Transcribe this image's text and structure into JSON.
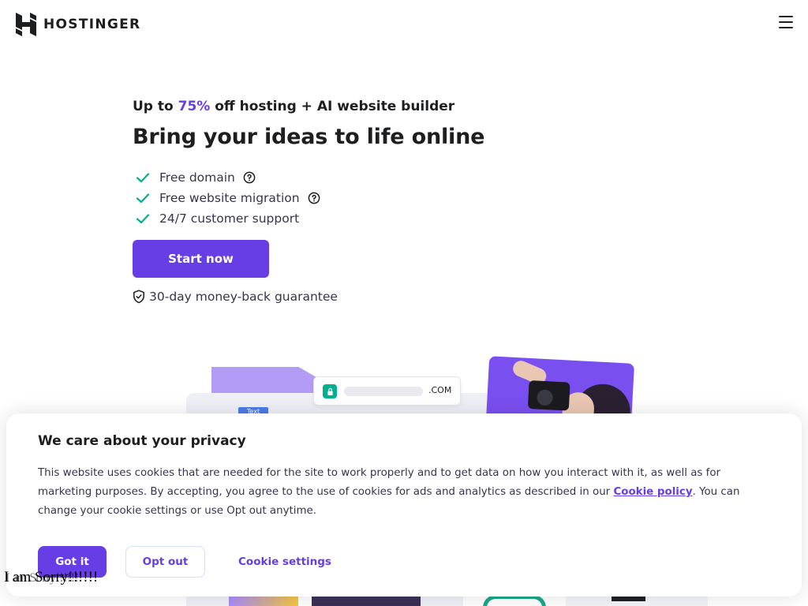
{
  "header": {
    "brand": "HOSTINGER",
    "logo_icon": "hostinger-h-logo",
    "menu_icon": "hamburger-menu-icon"
  },
  "hero": {
    "promo_prefix": "Up to ",
    "promo_highlight": "75%",
    "promo_suffix": " off hosting + AI website builder",
    "title": "Bring your ideas to life online",
    "features": [
      {
        "label": "Free domain",
        "has_help": true
      },
      {
        "label": "Free website migration",
        "has_help": true
      },
      {
        "label": "24/7 customer support",
        "has_help": false
      }
    ],
    "cta_label": "Start now",
    "guarantee": "30-day money-back guarantee"
  },
  "illustration": {
    "tag_label": "Text",
    "url_tld": ".COM"
  },
  "cookie": {
    "title": "We care about your privacy",
    "text_before_link": "This website uses cookies that are needed for the site to work properly and to get data on how you interact with it, as well as for marketing purposes. By accepting, you agree to the use of cookies for ads and analytics as described in our ",
    "link_label": "Cookie policy",
    "text_after_link": ". You can change your cookie settings or use Opt out anytime.",
    "got_it_label": "Got it",
    "opt_out_label": "Opt out",
    "settings_label": "Cookie settings"
  },
  "overlay": {
    "text": "I am Sorry!!!!!!"
  },
  "colors": {
    "brand_purple": "#673de6",
    "check_green": "#00b090",
    "text_dark": "#1d1e20"
  }
}
